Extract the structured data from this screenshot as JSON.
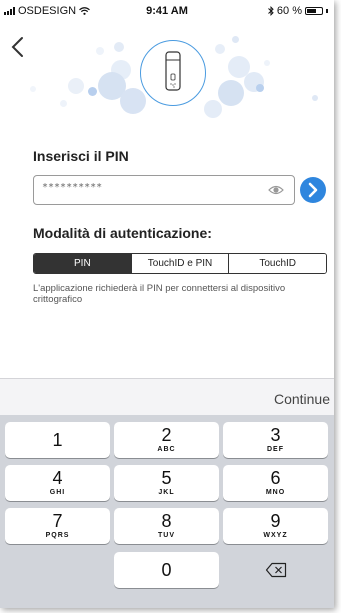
{
  "status_bar": {
    "carrier": "OSDESIGN",
    "time": "9:41 AM",
    "battery": "60 %"
  },
  "pin": {
    "title": "Inserisci il PIN",
    "value": "**********"
  },
  "auth": {
    "title": "Modalità di autenticazione:",
    "options": [
      "PIN",
      "TouchID e PIN",
      "TouchID"
    ],
    "selected": "PIN",
    "description": "L'applicazione richiederà il PIN per connettersi al dispositivo crittografico"
  },
  "keyboard": {
    "continue_label": "Continue",
    "keys": [
      {
        "num": "1",
        "letters": ""
      },
      {
        "num": "2",
        "letters": "ABC"
      },
      {
        "num": "3",
        "letters": "DEF"
      },
      {
        "num": "4",
        "letters": "GHI"
      },
      {
        "num": "5",
        "letters": "JKL"
      },
      {
        "num": "6",
        "letters": "MNO"
      },
      {
        "num": "7",
        "letters": "PQRS"
      },
      {
        "num": "8",
        "letters": "TUV"
      },
      {
        "num": "9",
        "letters": "WXYZ"
      },
      {
        "num": "0",
        "letters": ""
      }
    ]
  },
  "colors": {
    "accent": "#2f86de",
    "selected_segment": "#333333",
    "dots": "#dbe6f4"
  }
}
